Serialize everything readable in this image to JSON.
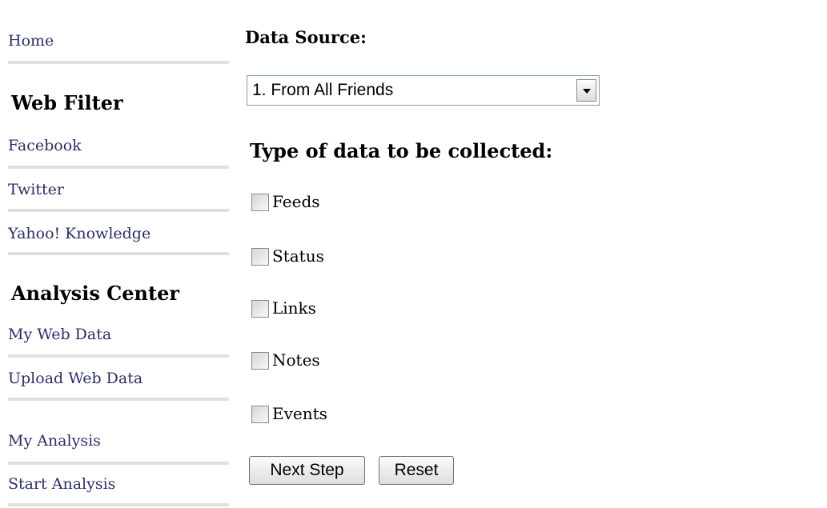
{
  "sidebar": {
    "home": "Home",
    "web_filter_heading": "Web Filter",
    "web_filter_items": [
      "Facebook",
      "Twitter",
      "Yahoo! Knowledge"
    ],
    "analysis_heading": "Analysis Center",
    "analysis_items": [
      "My Web Data",
      "Upload Web Data",
      "My Analysis",
      "Start Analysis"
    ]
  },
  "form": {
    "data_source_label": "Data Source:",
    "data_source_selected": "1. From All Friends",
    "data_type_label": "Type of data to be collected:",
    "data_types": [
      {
        "label": "Feeds",
        "checked": false
      },
      {
        "label": "Status",
        "checked": false
      },
      {
        "label": "Links",
        "checked": false
      },
      {
        "label": "Notes",
        "checked": false
      },
      {
        "label": "Events",
        "checked": false
      }
    ],
    "next_button": "Next Step",
    "reset_button": "Reset"
  }
}
